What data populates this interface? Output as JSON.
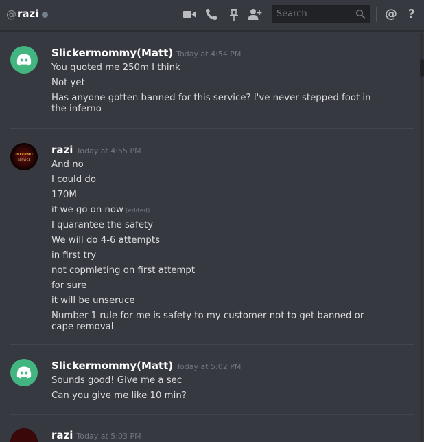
{
  "header": {
    "at_symbol": "@",
    "channel_name": "razi",
    "search_placeholder": "Search",
    "icons": [
      "video-call-icon",
      "voice-call-icon",
      "pin-icon",
      "add-friend-icon",
      "search-icon",
      "mention-icon",
      "help-icon"
    ],
    "mention_label": "@",
    "help_label": "?"
  },
  "colors": {
    "background": "#36393f",
    "search_bg": "#202225",
    "discord_green": "#43b581",
    "muted_text": "#72767d",
    "status_offline": "#747f8d"
  },
  "messages": [
    {
      "author": "Slickermommy(Matt)",
      "timestamp": "Today at 4:54 PM",
      "avatar": "discord-logo",
      "lines": [
        "You quoted me 250m I think",
        "Not yet",
        "Has anyone gotten banned for this service? I've never stepped foot in the inferno"
      ]
    },
    {
      "author": "razi",
      "timestamp": "Today at 4:55 PM",
      "avatar": "razi-inferno-avatar",
      "avatar_text": [
        "INFERNO",
        "SERVICE"
      ],
      "lines": [
        "And no",
        "I could do",
        "170M",
        "if we go on now",
        "I quarantee the safety",
        "We will do 4-6 attempts",
        "in first try",
        "not copmleting on first attempt",
        "for sure",
        "it will be unseruce",
        "Number 1 rule for me is safety to my customer not to get banned or cape removal"
      ],
      "edited_label": "(edited)"
    },
    {
      "author": "Slickermommy(Matt)",
      "timestamp": "Today at 5:02 PM",
      "avatar": "discord-logo",
      "lines": [
        "Sounds good! Give me a sec",
        "Can you give me like 10 min?"
      ]
    },
    {
      "author": "razi",
      "timestamp": "Today at 5:03 PM",
      "avatar": "razi-inferno-avatar",
      "lines": []
    }
  ]
}
